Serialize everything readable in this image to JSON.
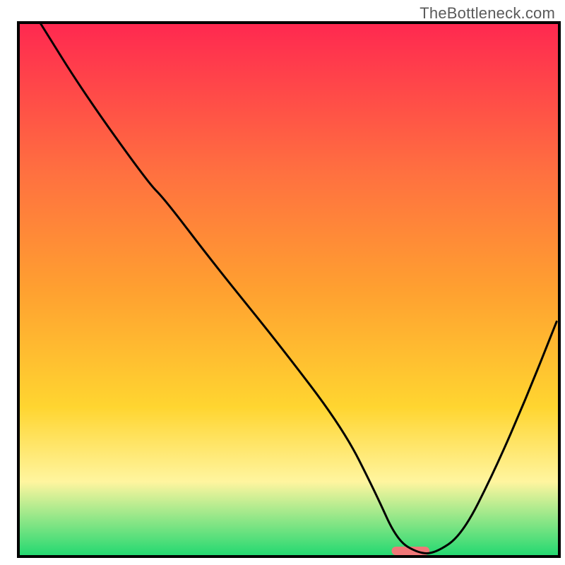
{
  "attribution": "TheBottleneck.com",
  "chart_data": {
    "type": "line",
    "title": "",
    "xlabel": "",
    "ylabel": "",
    "xlim": [
      0,
      100
    ],
    "ylim": [
      0,
      100
    ],
    "grid": false,
    "legend": false,
    "axes_visible": false,
    "gradient_colors": {
      "top": "#ff2850",
      "upper_mid": "#ff7040",
      "mid": "#ffa030",
      "lower_mid": "#ffd530",
      "pale_band": "#fff59f",
      "green": "#20d870"
    },
    "marker": {
      "x_start": 69,
      "x_end": 76,
      "color": "#f07878"
    },
    "series": [
      {
        "name": "bottleneck-curve",
        "color": "#000000",
        "x": [
          4,
          12,
          24,
          27,
          36,
          48,
          60,
          66,
          70,
          74,
          77,
          82,
          88,
          94,
          99.5
        ],
        "values": [
          100,
          87,
          70,
          67,
          55,
          40,
          24,
          12,
          3,
          0.6,
          0.6,
          4,
          16,
          30,
          44
        ]
      }
    ]
  }
}
